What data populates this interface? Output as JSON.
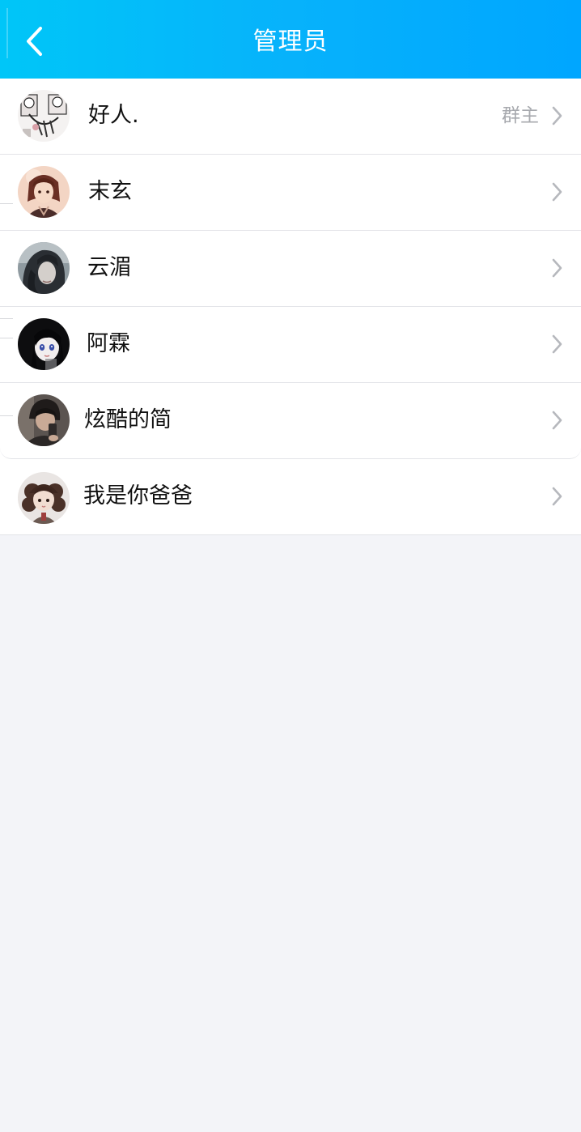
{
  "header": {
    "title": "管理员",
    "back_icon": "chevron-left-icon",
    "background_start": "#00c6f8",
    "background_end": "#00a6ff"
  },
  "admins": [
    {
      "name": "好人.",
      "role": "群主",
      "avatar_icon": "avatar-manga-collage"
    },
    {
      "name": "末玄",
      "role": "",
      "avatar_icon": "avatar-anime-brown-hair"
    },
    {
      "name": "云湄",
      "role": "",
      "avatar_icon": "avatar-dark-hair-portrait"
    },
    {
      "name": "阿霖",
      "role": "",
      "avatar_icon": "avatar-anime-black-hair"
    },
    {
      "name": "炫酷的简",
      "role": "",
      "avatar_icon": "avatar-mirror-selfie"
    },
    {
      "name": "我是你爸爸",
      "role": "",
      "avatar_icon": "avatar-chibi-curly-hair"
    }
  ],
  "row_chevron_icon": "chevron-right-icon",
  "colors": {
    "page_background": "#f3f4f8",
    "role_text": "#a7a9ae",
    "chevron": "#b6b8bd"
  }
}
